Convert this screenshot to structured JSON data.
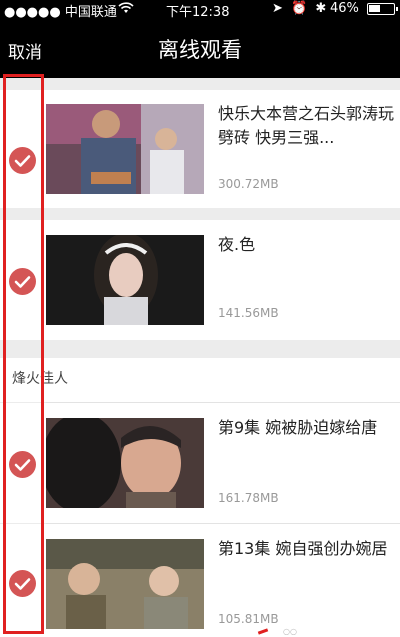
{
  "status_bar": {
    "carrier": "●●●●● 中国联通",
    "wifi_icon": "wifi-icon",
    "time": "下午12:38",
    "battery_percent": "46%"
  },
  "nav": {
    "cancel_label": "取消",
    "title": "离线观看"
  },
  "items": [
    {
      "title": "快乐大本营之石头郭涛玩劈砖 快男三强...",
      "size": "300.72MB",
      "checked": true
    },
    {
      "title": "夜.色",
      "size": "141.56MB",
      "checked": true
    }
  ],
  "section": {
    "title": "烽火佳人",
    "items": [
      {
        "title": "第9集 婉被胁迫嫁给唐",
        "size": "161.78MB",
        "checked": true
      },
      {
        "title": "第13集 婉自强创办婉居",
        "size": "105.81MB",
        "checked": true
      }
    ]
  },
  "colors": {
    "check_fill": "#d45555",
    "annotation_box": "#e02020",
    "bar_bg": "#000000"
  }
}
